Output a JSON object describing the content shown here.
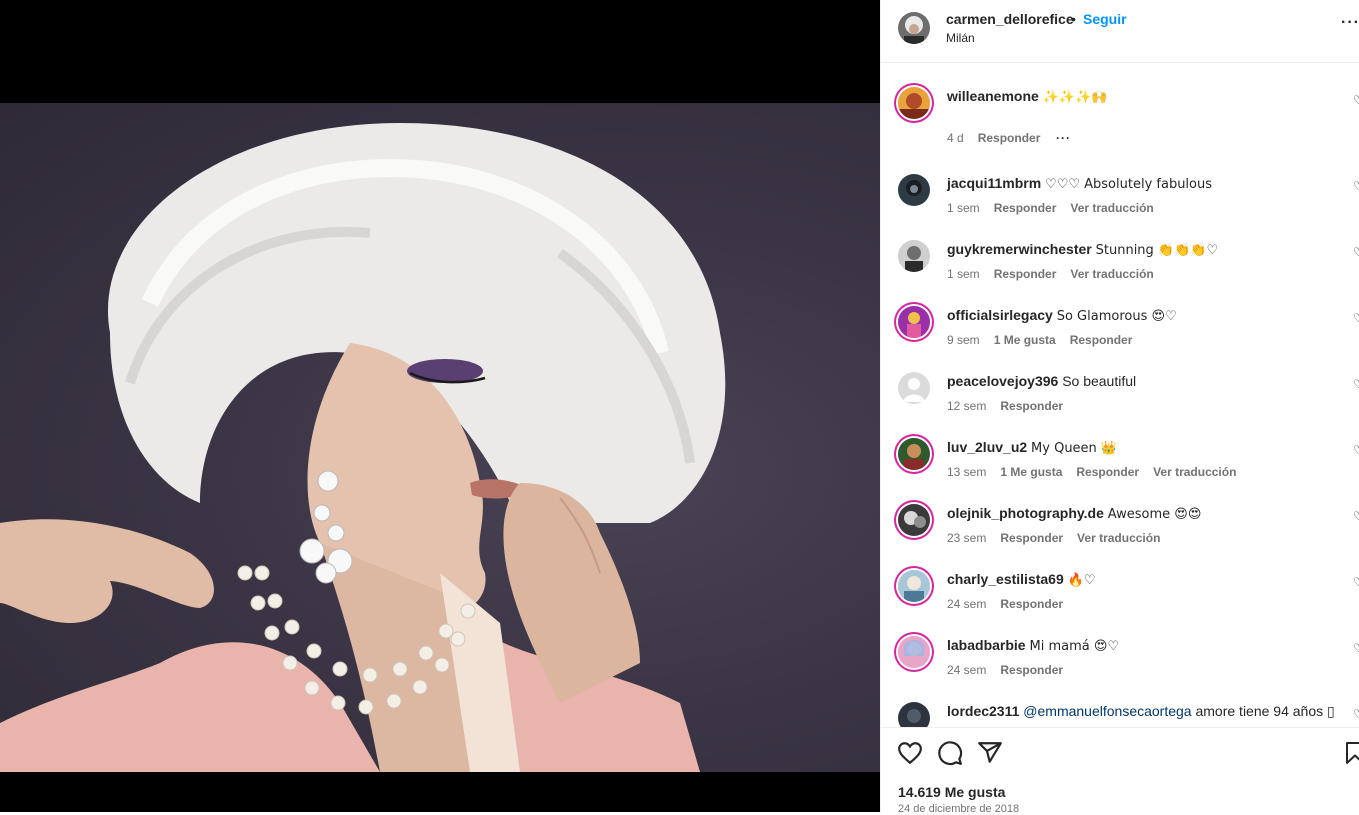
{
  "post": {
    "username": "carmen_dellorefice",
    "separator": "•",
    "follow_label": "Seguir",
    "location": "Milán",
    "more": "···"
  },
  "comments": [
    {
      "user": "willeanemone",
      "text": "✨✨✨🙌",
      "time": "4 d",
      "likes": "",
      "reply": "Responder",
      "translate": "",
      "options": "···"
    },
    {
      "user": "jacqui11mbrm",
      "text": "♡♡♡ Absolutely fabulous",
      "time": "1 sem",
      "likes": "",
      "reply": "Responder",
      "translate": "Ver traducción"
    },
    {
      "user": "guykremerwinchester",
      "text": "Stunning 👏👏👏♡",
      "time": "1 sem",
      "likes": "",
      "reply": "Responder",
      "translate": "Ver traducción"
    },
    {
      "user": "officialsirlegacy",
      "text": "So Glamorous 😍♡",
      "time": "9 sem",
      "likes": "1 Me gusta",
      "reply": "Responder",
      "translate": ""
    },
    {
      "user": "peacelovejoy396",
      "text": "So beautiful",
      "time": "12 sem",
      "likes": "",
      "reply": "Responder",
      "translate": ""
    },
    {
      "user": "luv_2luv_u2",
      "text": "My Queen 👑",
      "time": "13 sem",
      "likes": "1 Me gusta",
      "reply": "Responder",
      "translate": "Ver traducción"
    },
    {
      "user": "olejnik_photography.de",
      "text": "Awesome 😍😍",
      "time": "23 sem",
      "likes": "",
      "reply": "Responder",
      "translate": "Ver traducción"
    },
    {
      "user": "charly_estilista69",
      "text": "🔥♡",
      "time": "24 sem",
      "likes": "",
      "reply": "Responder",
      "translate": ""
    },
    {
      "user": "labadbarbie",
      "text": "Mi mamá 😍♡",
      "time": "24 sem",
      "likes": "",
      "reply": "Responder",
      "translate": ""
    },
    {
      "user": "lordec2311",
      "mention": "@emmanuelfonsecaortega",
      "text": "amore tiene 94 años ▯",
      "time": "",
      "likes": "",
      "reply": "",
      "translate": ""
    }
  ],
  "actions": {
    "like_icon": "heart-icon",
    "comment_icon": "comment-icon",
    "share_icon": "share-icon",
    "save_icon": "bookmark-icon",
    "likes": "14.619 Me gusta",
    "date": "24 de diciembre de 2018"
  }
}
